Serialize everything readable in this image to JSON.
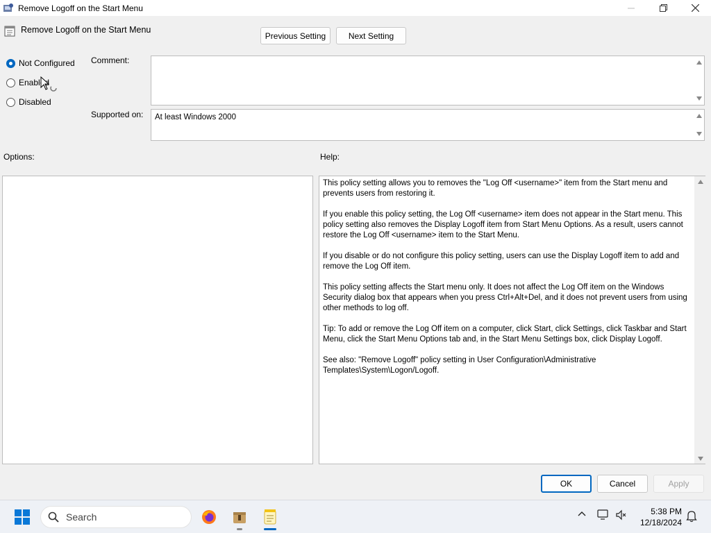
{
  "window": {
    "title": "Remove Logoff on the Start Menu",
    "controls": [
      "minimize",
      "maximize",
      "close"
    ]
  },
  "header": {
    "policy_name": "Remove Logoff on the Start Menu",
    "prev_label": "Previous Setting",
    "next_label": "Next Setting"
  },
  "state": {
    "options": [
      {
        "label": "Not Configured",
        "checked": true
      },
      {
        "label": "Enabled",
        "checked": false
      },
      {
        "label": "Disabled",
        "checked": false
      }
    ]
  },
  "comment": {
    "label": "Comment:",
    "value": ""
  },
  "supported": {
    "label": "Supported on:",
    "value": "At least Windows 2000"
  },
  "options_label": "Options:",
  "help": {
    "label": "Help:",
    "text": "This policy setting allows you to removes the \"Log Off <username>\" item from the Start menu and prevents users from restoring it.\n\nIf you enable this policy setting, the Log Off <username> item does not appear in the Start menu. This policy setting also removes the Display Logoff item from Start Menu Options. As a result, users cannot restore the Log Off <username> item to the Start Menu.\n\nIf you disable or do not configure this policy setting, users can use the Display Logoff item to add and remove the Log Off item.\n\nThis policy setting affects the Start menu only. It does not affect the Log Off item on the Windows Security dialog box that appears when you press Ctrl+Alt+Del, and it does not prevent users from using other methods to log off.\n\nTip: To add or remove the Log Off item on a computer, click Start, click Settings, click Taskbar and Start Menu, click the Start Menu Options tab and, in the Start Menu Settings box, click Display Logoff.\n\nSee also: \"Remove Logoff\" policy setting in User Configuration\\Administrative Templates\\System\\Logon/Logoff."
  },
  "footer": {
    "ok": "OK",
    "cancel": "Cancel",
    "apply": "Apply"
  },
  "taskbar": {
    "search_placeholder": "Search",
    "apps": [
      "firefox-icon",
      "archive-icon",
      "notepad-icon"
    ],
    "time": "5:38 PM",
    "date": "12/18/2024"
  },
  "colors": {
    "accent": "#0067c0",
    "start_blue": "#0a78d7"
  }
}
